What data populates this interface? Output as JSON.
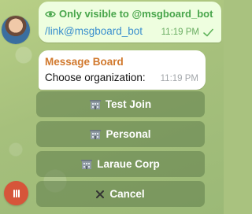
{
  "outgoing": {
    "visibility_note": "Only visible to @msgboard_bot",
    "text": "/link@msgboard_bot",
    "time": "11:19 PM",
    "status_icon": "check-icon"
  },
  "incoming": {
    "sender": "Message Board",
    "text": "Choose organization:",
    "time": "11:19 PM"
  },
  "keyboard": {
    "buttons": [
      {
        "label": "Test Join",
        "icon": "building-icon"
      },
      {
        "label": "Personal",
        "icon": "building-icon"
      },
      {
        "label": "Laraue Corp",
        "icon": "building-icon"
      },
      {
        "label": "Cancel",
        "icon": "cross-icon"
      }
    ]
  },
  "colors": {
    "accent_green": "#48a54b",
    "link": "#3a8fce",
    "sender": "#d1792e",
    "menu_button": "#d6553a"
  }
}
